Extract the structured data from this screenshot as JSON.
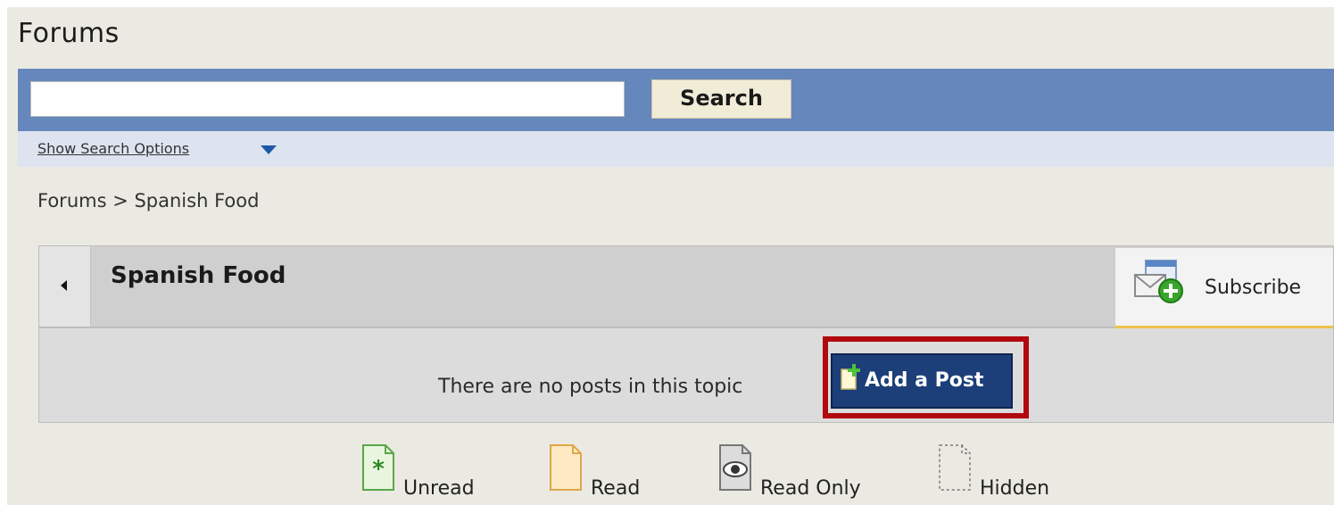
{
  "page": {
    "title": "Forums"
  },
  "search": {
    "value": "",
    "placeholder": "",
    "button_label": "Search",
    "options_label": "Show Search Options"
  },
  "breadcrumb": {
    "text": "Forums > Spanish Food"
  },
  "topic": {
    "title": "Spanish Food",
    "subscribe_label": "Subscribe",
    "empty_message": "There are no posts in this topic",
    "add_post_label": "Add a Post"
  },
  "legend": {
    "items": [
      {
        "label": "Unread",
        "icon": "unread-icon"
      },
      {
        "label": "Read",
        "icon": "read-icon"
      },
      {
        "label": "Read Only",
        "icon": "read-only-icon"
      },
      {
        "label": "Hidden",
        "icon": "hidden-icon"
      }
    ]
  },
  "colors": {
    "page_background": "#ebeae2",
    "search_bar": "#6587bc",
    "search_options_bar": "#dde3ef",
    "add_post_button": "#1d3f79",
    "highlight_border": "#b0090e",
    "subscribe_underline": "#f0c24b"
  }
}
